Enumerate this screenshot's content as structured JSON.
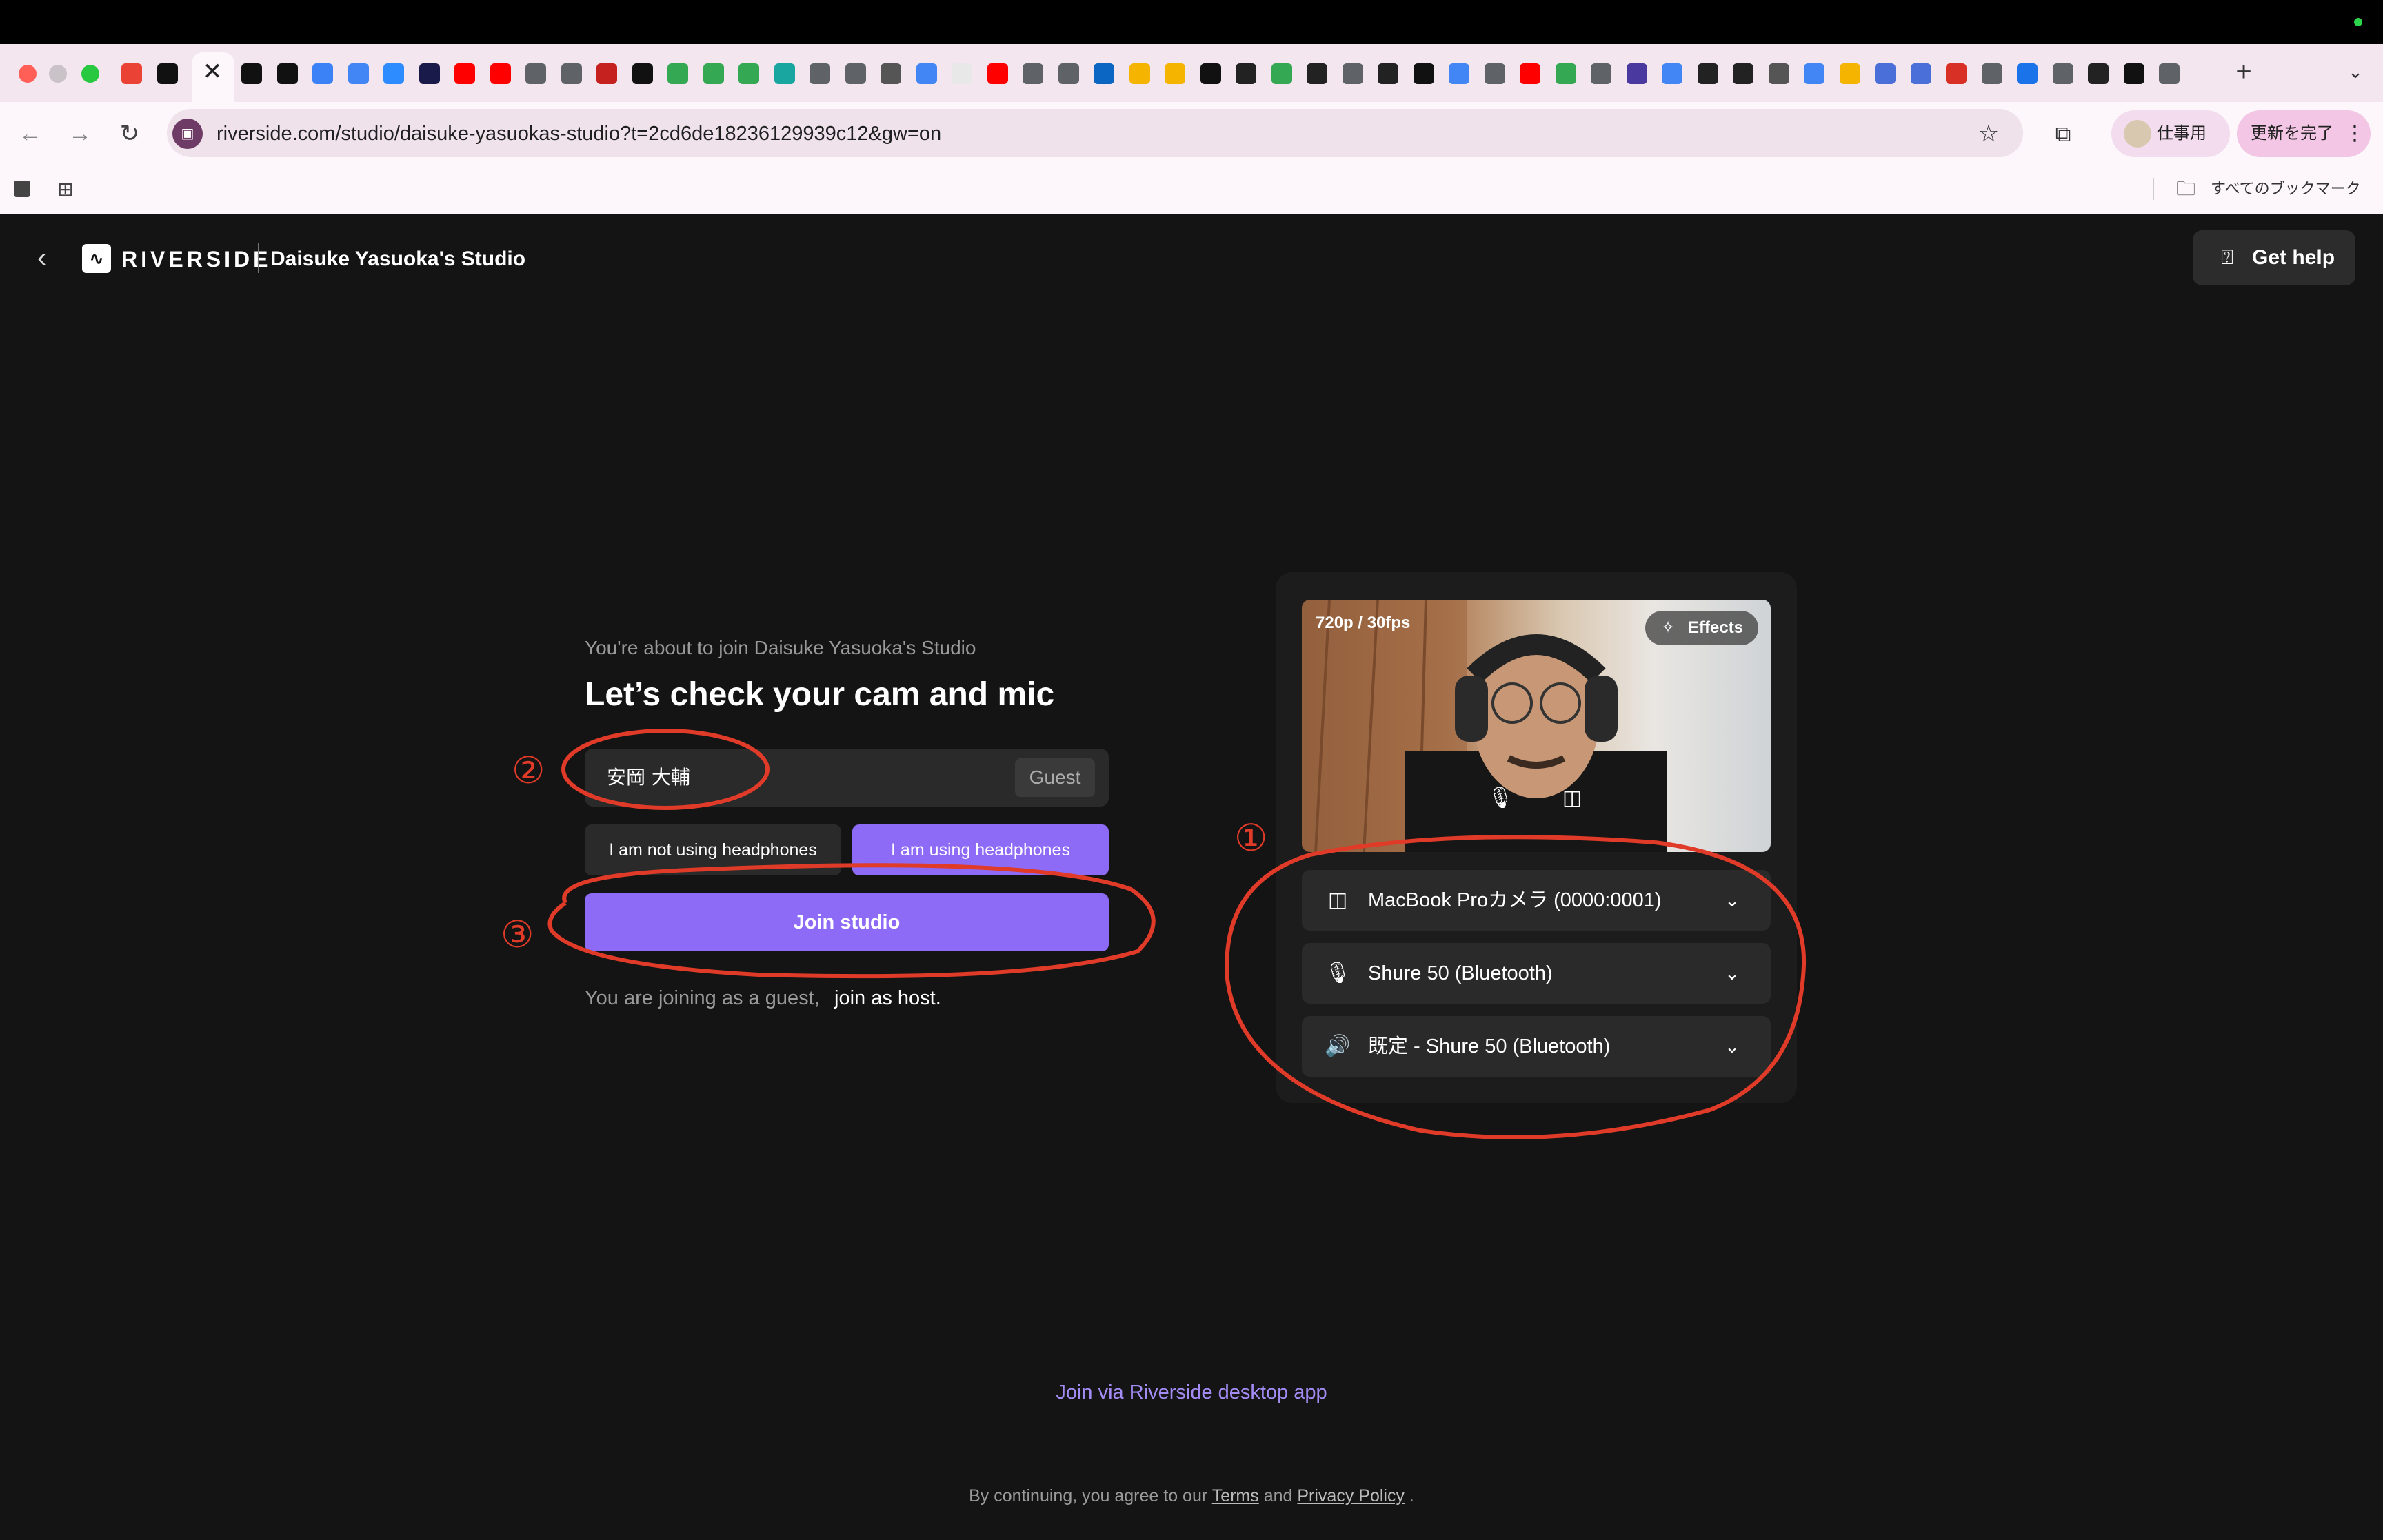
{
  "browser": {
    "url": "riverside.com/studio/daisuke-yasuokas-studio?t=2cd6de18236129939c12&gw=on",
    "profile_label": "仕事用",
    "update_label": "更新を完了",
    "all_bookmarks_label": "すべてのブックマーク",
    "tab_close_glyph": "✕",
    "new_tab_glyph": "+",
    "favicon_colors": [
      "#ea4335",
      "#111111",
      "#111111",
      "#111111",
      "#3b82f6",
      "#4285f4",
      "#2d8cff",
      "#1a1a4a",
      "#ff0000",
      "#ff0000",
      "#5f6368",
      "#5f6368",
      "#c5221f",
      "#111111",
      "#34a853",
      "#34a853",
      "#34a853",
      "#1aa6a0",
      "#5f6368",
      "#5f6368",
      "#555555",
      "#4285f4",
      "#e8e8e8",
      "#ff0000",
      "#5f6368",
      "#5f6368",
      "#0a66c2",
      "#f4b400",
      "#f4b400",
      "#111111",
      "#222222",
      "#34a853",
      "#222222",
      "#5f6368",
      "#222222",
      "#111111",
      "#4285f4",
      "#5f6368",
      "#ff0000",
      "#34a853",
      "#5f6368",
      "#4a3aa0",
      "#4285f4",
      "#222222",
      "#222222",
      "#555555",
      "#4285f4",
      "#f4b400",
      "#4a6fd8",
      "#4a6fd8",
      "#d93025",
      "#5f6368",
      "#1a73e8",
      "#5f6368",
      "#222222",
      "#111111",
      "#5f6368"
    ]
  },
  "header": {
    "back_glyph": "‹",
    "logo_text": "RIVERSIDE",
    "studio_name": "Daisuke Yasuoka's Studio",
    "help_label": "Get help"
  },
  "join": {
    "about_to_join": "You're about to join Daisuke Yasuoka's Studio",
    "headline": "Let’s check your cam and mic",
    "name_value": "安岡 大輔",
    "guest_badge": "Guest",
    "headphones_no": "I am not using headphones",
    "headphones_yes": "I am using headphones",
    "join_button": "Join studio",
    "guest_note": "You are joining as a guest,",
    "host_link": "join as host."
  },
  "preview": {
    "resolution": "720p / 30fps",
    "effects_label": "Effects",
    "camera_device": "MacBook Proカメラ (0000:0001)",
    "mic_device": "Shure 50 (Bluetooth)",
    "speaker_device": "既定 - Shure 50 (Bluetooth)"
  },
  "footer": {
    "desktop_link": "Join via Riverside desktop app",
    "agree_prefix": "By continuing, you agree to our",
    "terms": "Terms",
    "and": "and",
    "privacy": "Privacy Policy",
    "suffix": "."
  },
  "annotations": {
    "marker_1": "①",
    "marker_2": "②",
    "marker_3": "③",
    "color": "#e03a28"
  },
  "colors": {
    "accent": "#8e6bf7",
    "link": "#a48cf5",
    "page_bg": "#141414"
  }
}
